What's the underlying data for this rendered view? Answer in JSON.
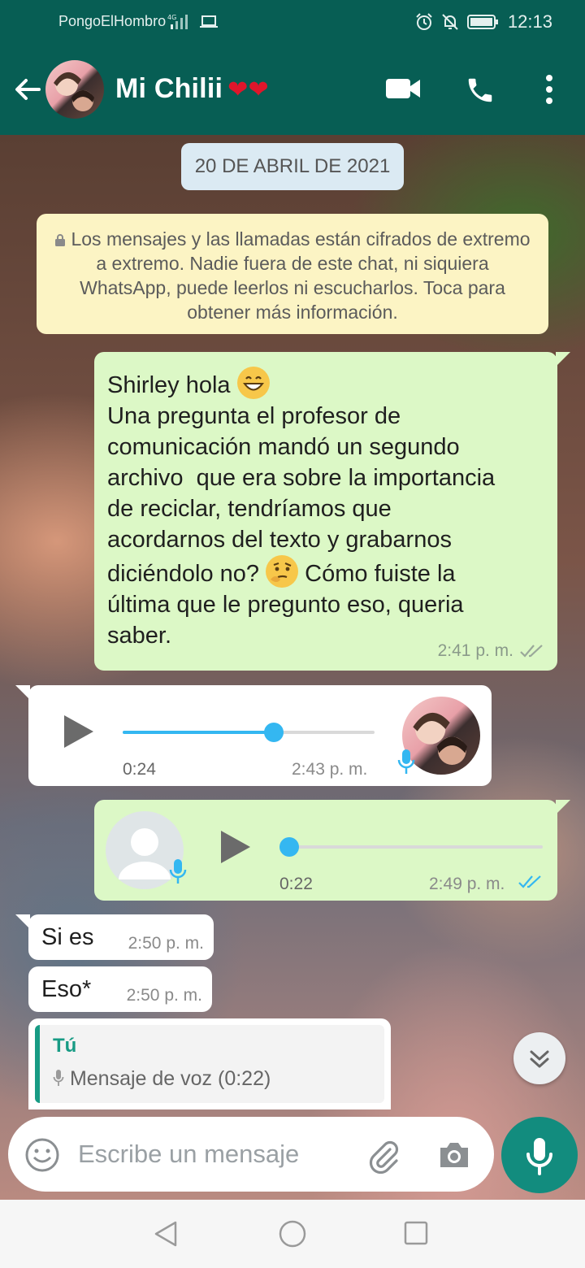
{
  "status_bar": {
    "carrier": "PongoElHombro",
    "network": "4G",
    "time": "12:13"
  },
  "header": {
    "contact_name": "Mi Chilii",
    "name_emoji": "❤❤",
    "icons": [
      "back-arrow-icon",
      "video-call-icon",
      "phone-icon",
      "more-vert-icon"
    ]
  },
  "chat": {
    "date_chip": "20 DE ABRIL DE 2021",
    "encryption_notice": "Los mensajes y las llamadas están cifrados de extremo a extremo. Nadie fuera de este chat, ni siquiera WhatsApp, puede leerlos ni escucharlos. Toca para obtener más información.",
    "messages": [
      {
        "type": "text",
        "direction": "out",
        "line1": "Shirley hola",
        "body_a": "Una pregunta el profesor de\ncomunicación mandó un segundo\narchivo  que era sobre la importancia\nde reciclar, tendríamos que\nacordarnos del texto y grabarnos\ndiciéndolo no?",
        "body_b": "Cómo fuiste la",
        "body_c": "última que le pregunto eso, queria\nsaber.",
        "time": "2:41 p. m.",
        "status": "delivered"
      },
      {
        "type": "voice",
        "direction": "in",
        "duration": "0:24",
        "time": "2:43 p. m.",
        "progress": 0.6
      },
      {
        "type": "voice",
        "direction": "out",
        "duration": "0:22",
        "time": "2:49 p. m.",
        "progress": 0.0,
        "status": "read"
      },
      {
        "type": "text",
        "direction": "in",
        "text": "Si es",
        "time": "2:50 p. m."
      },
      {
        "type": "text",
        "direction": "in",
        "text": "Eso*",
        "time": "2:50 p. m."
      }
    ],
    "quoted_reply": {
      "author": "Tú",
      "content": "Mensaje de voz (0:22)"
    }
  },
  "composer": {
    "placeholder": "Escribe un mensaje",
    "icons": [
      "emoji-icon",
      "attach-icon",
      "camera-icon",
      "mic-icon"
    ]
  },
  "colors": {
    "header": "#075e54",
    "outgoing_bubble": "#dcf8c6",
    "incoming_bubble": "#ffffff",
    "accent_blue": "#34b7f1",
    "fab": "#128c7e"
  }
}
